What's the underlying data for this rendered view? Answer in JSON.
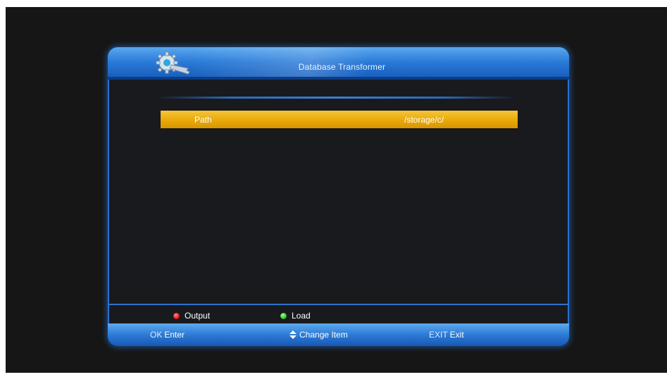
{
  "dialog": {
    "title": "Database Transformer",
    "logo_icon": "gear-wrench-icon"
  },
  "menu": {
    "items": [
      {
        "label": "Path",
        "value": "/storage/c/",
        "selected": true
      }
    ]
  },
  "color_keys": [
    {
      "color": "#e01818",
      "label": "Output",
      "icon": "red-dot-icon"
    },
    {
      "color": "#2fc02a",
      "label": "Load",
      "icon": "green-dot-icon"
    }
  ],
  "footer": {
    "ok": {
      "key": "OK",
      "label": "Enter"
    },
    "nav": {
      "icon": "up-down-arrow-icon",
      "label": "Change Item"
    },
    "exit": {
      "key": "EXIT",
      "label": "Exit"
    }
  },
  "colors": {
    "accent_blue": "#2a7ad8",
    "highlight_yellow": "#e9a909",
    "background": "#161616"
  }
}
